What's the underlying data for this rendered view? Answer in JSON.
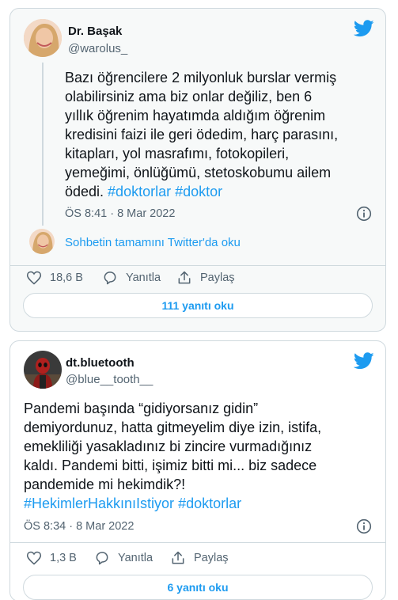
{
  "tweets": [
    {
      "display_name": "Dr. Başak",
      "handle": "@warolus_",
      "text_lines": [
        "Bazı öğrencilere 2 milyonluk burslar vermiş",
        "olabilirsiniz ama biz onlar değiliz, ben 6",
        "yıllık öğrenim hayatımda aldığım öğrenim",
        "kredisini faizi ile geri ödedim, harç parasını,",
        "kitapları, yol masrafımı, fotokopileri,",
        "yemeğimi, önlüğümü, stetoskobumu ailem"
      ],
      "text_last_plain": "ödedi. ",
      "hashtags": [
        "#doktorlar",
        "#doktor"
      ],
      "timestamp": "ÖS 8:41 · 8 Mar 2022",
      "thread_link": "Sohbetin tamamını Twitter'da oku",
      "likes": "18,6 B",
      "reply_label": "Yanıtla",
      "share_label": "Paylaş",
      "read_replies": "111 yanıtı oku"
    },
    {
      "display_name": "dt.bluetooth",
      "handle": "@blue__tooth__",
      "text_lines": [
        "Pandemi başında “gidiyorsanız gidin”",
        "demiyordunuz, hatta gitmeyelim diye izin, istifa,",
        "emekliliği yasakladınız bi zincire vurmadığınız",
        "kaldı. Pandemi bitti, işimiz bitti mi... biz sadece",
        "pandemide mi hekimdik?!"
      ],
      "hashtags": [
        "#HekimlerHakkınıIstiyor",
        "#doktorlar"
      ],
      "timestamp": "ÖS 8:34 · 8 Mar 2022",
      "likes": "1,3 B",
      "reply_label": "Yanıtla",
      "share_label": "Paylaş",
      "read_replies": "6 yanıtı oku"
    }
  ],
  "colors": {
    "accent": "#1d9bf0",
    "text": "#0f1419",
    "muted": "#536471",
    "border": "#cfd9de",
    "card1_bg": "#f7f9f9"
  },
  "icons": {
    "brand": "twitter-bird-icon",
    "like": "heart-icon",
    "reply": "speech-bubble-icon",
    "share": "share-arrow-icon",
    "info": "info-icon"
  }
}
